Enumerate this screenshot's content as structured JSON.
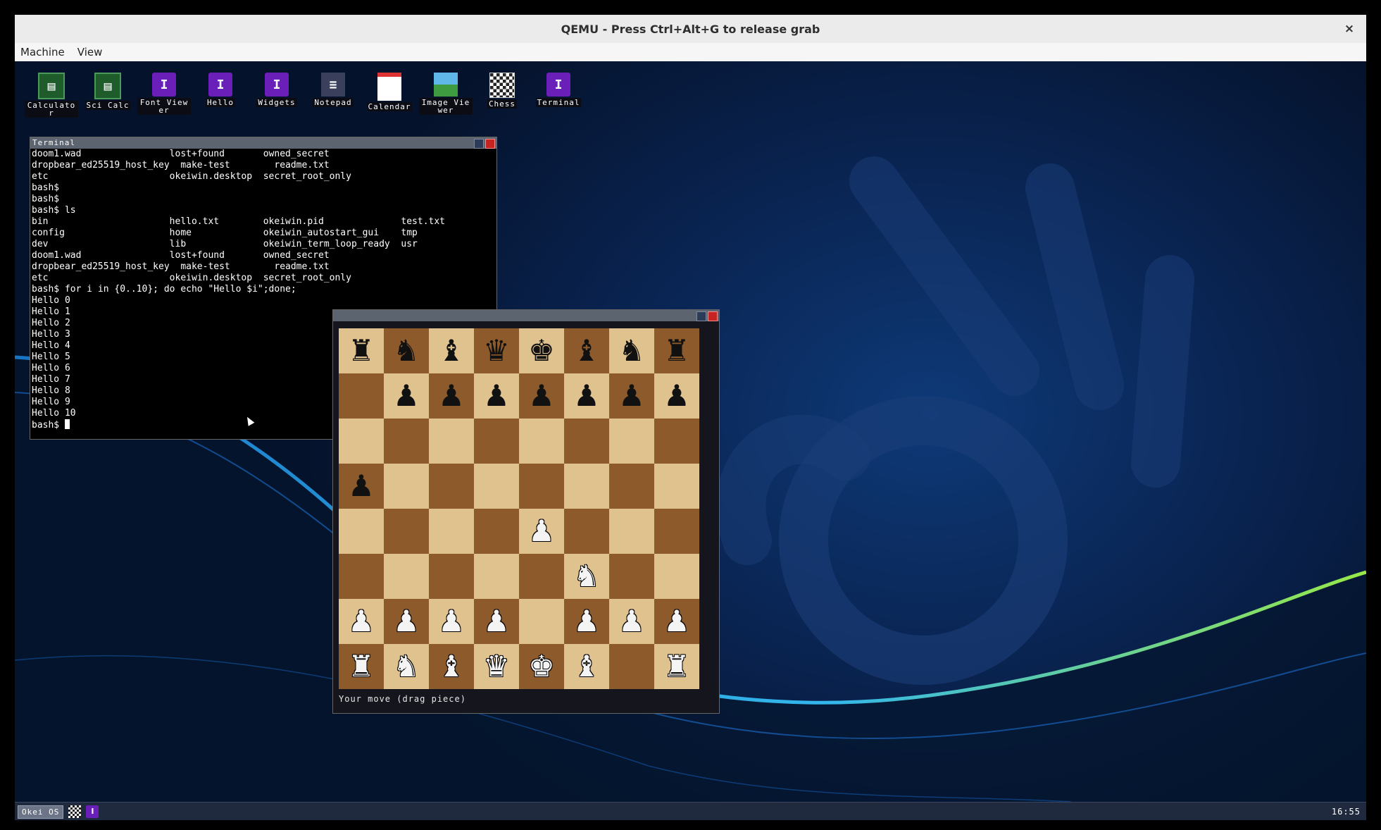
{
  "host": {
    "title": "QEMU - Press Ctrl+Alt+G to release grab",
    "close_glyph": "×",
    "menu": [
      "Machine",
      "View"
    ]
  },
  "desktop_icons": [
    {
      "label": "Calculator",
      "icon": "calculator-icon",
      "glyph": "▤"
    },
    {
      "label": "Sci Calc",
      "icon": "sci-calc-icon",
      "glyph": "▤"
    },
    {
      "label": "Font Viewer",
      "icon": "app-icon",
      "glyph": "I"
    },
    {
      "label": "Hello",
      "icon": "app-icon",
      "glyph": "I"
    },
    {
      "label": "Widgets",
      "icon": "app-icon",
      "glyph": "I"
    },
    {
      "label": "Notepad",
      "icon": "notepad-icon",
      "glyph": "≡"
    },
    {
      "label": "Calendar",
      "icon": "calendar-icon",
      "glyph": "▦"
    },
    {
      "label": "Image Viewer",
      "icon": "image-icon",
      "glyph": ""
    },
    {
      "label": "Chess",
      "icon": "chess-board-icon",
      "glyph": ""
    },
    {
      "label": "Terminal",
      "icon": "terminal-icon",
      "glyph": "I"
    }
  ],
  "terminal": {
    "title": "Terminal",
    "lines": [
      "doom1.wad                lost+found       owned_secret",
      "dropbear_ed25519_host_key  make-test        readme.txt",
      "etc                      okeiwin.desktop  secret_root_only",
      "bash$",
      "bash$",
      "bash$ ls",
      "bin                      hello.txt        okeiwin.pid              test.txt",
      "config                   home             okeiwin_autostart_gui    tmp",
      "dev                      lib              okeiwin_term_loop_ready  usr",
      "doom1.wad                lost+found       owned_secret",
      "dropbear_ed25519_host_key  make-test        readme.txt",
      "etc                      okeiwin.desktop  secret_root_only",
      "bash$ for i in {0..10}; do echo \"Hello $i\";done;",
      "Hello 0",
      "Hello 1",
      "Hello 2",
      "Hello 3",
      "Hello 4",
      "Hello 5",
      "Hello 6",
      "Hello 7",
      "Hello 8",
      "Hello 9",
      "Hello 10"
    ],
    "prompt": "bash$ "
  },
  "chess": {
    "title": "",
    "status": "Your move (drag piece)",
    "board": [
      [
        "br",
        "bn",
        "bb",
        "bq",
        "bk",
        "bb",
        "bn",
        "br"
      ],
      [
        "",
        "bp",
        "bp",
        "bp",
        "bp",
        "bp",
        "bp",
        "bp"
      ],
      [
        "",
        "",
        "",
        "",
        "",
        "",
        "",
        ""
      ],
      [
        "bp",
        "",
        "",
        "",
        "",
        "",
        "",
        ""
      ],
      [
        "",
        "",
        "",
        "",
        "wp",
        "",
        "",
        ""
      ],
      [
        "",
        "",
        "",
        "",
        "",
        "wn",
        "",
        ""
      ],
      [
        "wp",
        "wp",
        "wp",
        "wp",
        "",
        "wp",
        "wp",
        "wp"
      ],
      [
        "wr",
        "wn",
        "wb",
        "wq",
        "wk",
        "wb",
        "",
        "wr"
      ]
    ],
    "glyphs": {
      "k": "♚",
      "q": "♛",
      "r": "♜",
      "b": "♝",
      "n": "♞",
      "p": "♟"
    },
    "colors": {
      "light": "#e0c28e",
      "dark": "#8c5a2b"
    }
  },
  "taskbar": {
    "start_label": "Okei OS",
    "clock": "16:55"
  }
}
